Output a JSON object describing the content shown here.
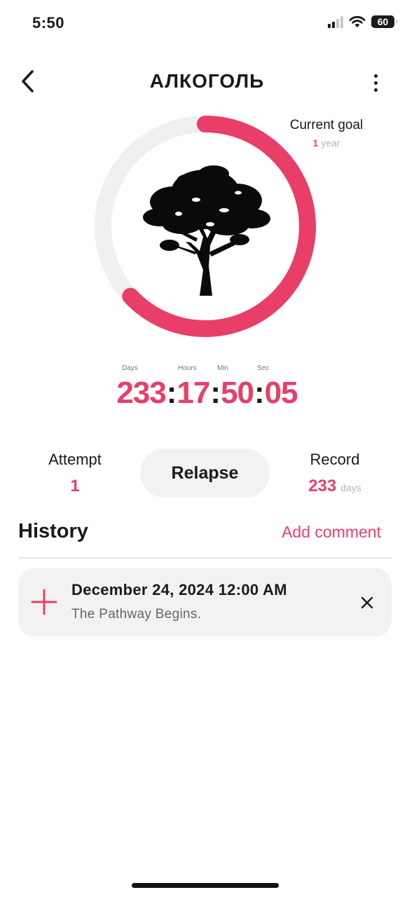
{
  "status_bar": {
    "time": "5:50",
    "battery": "60"
  },
  "header": {
    "title": "АЛКОГОЛЬ"
  },
  "goal": {
    "label": "Current goal",
    "value": "1",
    "unit": "year",
    "progress_fraction": 0.63
  },
  "timer": {
    "labels": {
      "days": "Days",
      "hours": "Hours",
      "min": "Min",
      "sec": "Sec"
    },
    "days": "233",
    "hours": "17",
    "min": "50",
    "sec": "05"
  },
  "stats": {
    "attempt_label": "Attempt",
    "attempt_value": "1",
    "relapse_label": "Relapse",
    "record_label": "Record",
    "record_value": "233",
    "record_unit": "days"
  },
  "history": {
    "title": "History",
    "add_comment": "Add comment",
    "entries": [
      {
        "date": "December 24, 2024 12:00 AM",
        "text": "The Pathway Begins."
      }
    ]
  },
  "colors": {
    "accent": "#e83e68",
    "track": "#f0f0f0",
    "card": "#f2f2f2"
  },
  "icons": [
    "back-chevron-icon",
    "more-vertical-icon",
    "tree-icon",
    "plus-icon",
    "close-icon",
    "signal-icon",
    "wifi-icon",
    "battery-icon"
  ]
}
